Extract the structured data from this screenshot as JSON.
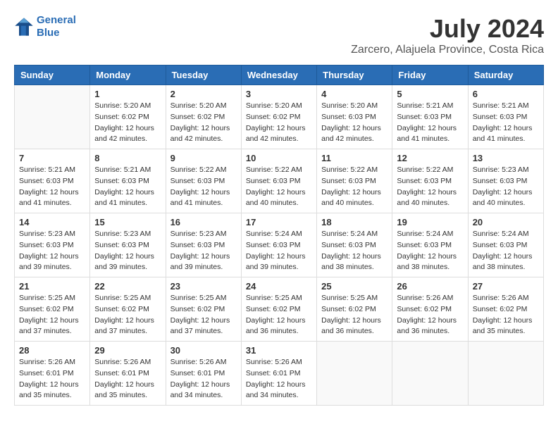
{
  "logo": {
    "name1": "General",
    "name2": "Blue"
  },
  "title": {
    "month_year": "July 2024",
    "location": "Zarcero, Alajuela Province, Costa Rica"
  },
  "weekdays": [
    "Sunday",
    "Monday",
    "Tuesday",
    "Wednesday",
    "Thursday",
    "Friday",
    "Saturday"
  ],
  "weeks": [
    [
      {
        "day": "",
        "info": ""
      },
      {
        "day": "1",
        "info": "Sunrise: 5:20 AM\nSunset: 6:02 PM\nDaylight: 12 hours\nand 42 minutes."
      },
      {
        "day": "2",
        "info": "Sunrise: 5:20 AM\nSunset: 6:02 PM\nDaylight: 12 hours\nand 42 minutes."
      },
      {
        "day": "3",
        "info": "Sunrise: 5:20 AM\nSunset: 6:02 PM\nDaylight: 12 hours\nand 42 minutes."
      },
      {
        "day": "4",
        "info": "Sunrise: 5:20 AM\nSunset: 6:03 PM\nDaylight: 12 hours\nand 42 minutes."
      },
      {
        "day": "5",
        "info": "Sunrise: 5:21 AM\nSunset: 6:03 PM\nDaylight: 12 hours\nand 41 minutes."
      },
      {
        "day": "6",
        "info": "Sunrise: 5:21 AM\nSunset: 6:03 PM\nDaylight: 12 hours\nand 41 minutes."
      }
    ],
    [
      {
        "day": "7",
        "info": "Sunrise: 5:21 AM\nSunset: 6:03 PM\nDaylight: 12 hours\nand 41 minutes."
      },
      {
        "day": "8",
        "info": "Sunrise: 5:21 AM\nSunset: 6:03 PM\nDaylight: 12 hours\nand 41 minutes."
      },
      {
        "day": "9",
        "info": "Sunrise: 5:22 AM\nSunset: 6:03 PM\nDaylight: 12 hours\nand 41 minutes."
      },
      {
        "day": "10",
        "info": "Sunrise: 5:22 AM\nSunset: 6:03 PM\nDaylight: 12 hours\nand 40 minutes."
      },
      {
        "day": "11",
        "info": "Sunrise: 5:22 AM\nSunset: 6:03 PM\nDaylight: 12 hours\nand 40 minutes."
      },
      {
        "day": "12",
        "info": "Sunrise: 5:22 AM\nSunset: 6:03 PM\nDaylight: 12 hours\nand 40 minutes."
      },
      {
        "day": "13",
        "info": "Sunrise: 5:23 AM\nSunset: 6:03 PM\nDaylight: 12 hours\nand 40 minutes."
      }
    ],
    [
      {
        "day": "14",
        "info": "Sunrise: 5:23 AM\nSunset: 6:03 PM\nDaylight: 12 hours\nand 39 minutes."
      },
      {
        "day": "15",
        "info": "Sunrise: 5:23 AM\nSunset: 6:03 PM\nDaylight: 12 hours\nand 39 minutes."
      },
      {
        "day": "16",
        "info": "Sunrise: 5:23 AM\nSunset: 6:03 PM\nDaylight: 12 hours\nand 39 minutes."
      },
      {
        "day": "17",
        "info": "Sunrise: 5:24 AM\nSunset: 6:03 PM\nDaylight: 12 hours\nand 39 minutes."
      },
      {
        "day": "18",
        "info": "Sunrise: 5:24 AM\nSunset: 6:03 PM\nDaylight: 12 hours\nand 38 minutes."
      },
      {
        "day": "19",
        "info": "Sunrise: 5:24 AM\nSunset: 6:03 PM\nDaylight: 12 hours\nand 38 minutes."
      },
      {
        "day": "20",
        "info": "Sunrise: 5:24 AM\nSunset: 6:03 PM\nDaylight: 12 hours\nand 38 minutes."
      }
    ],
    [
      {
        "day": "21",
        "info": "Sunrise: 5:25 AM\nSunset: 6:02 PM\nDaylight: 12 hours\nand 37 minutes."
      },
      {
        "day": "22",
        "info": "Sunrise: 5:25 AM\nSunset: 6:02 PM\nDaylight: 12 hours\nand 37 minutes."
      },
      {
        "day": "23",
        "info": "Sunrise: 5:25 AM\nSunset: 6:02 PM\nDaylight: 12 hours\nand 37 minutes."
      },
      {
        "day": "24",
        "info": "Sunrise: 5:25 AM\nSunset: 6:02 PM\nDaylight: 12 hours\nand 36 minutes."
      },
      {
        "day": "25",
        "info": "Sunrise: 5:25 AM\nSunset: 6:02 PM\nDaylight: 12 hours\nand 36 minutes."
      },
      {
        "day": "26",
        "info": "Sunrise: 5:26 AM\nSunset: 6:02 PM\nDaylight: 12 hours\nand 36 minutes."
      },
      {
        "day": "27",
        "info": "Sunrise: 5:26 AM\nSunset: 6:02 PM\nDaylight: 12 hours\nand 35 minutes."
      }
    ],
    [
      {
        "day": "28",
        "info": "Sunrise: 5:26 AM\nSunset: 6:01 PM\nDaylight: 12 hours\nand 35 minutes."
      },
      {
        "day": "29",
        "info": "Sunrise: 5:26 AM\nSunset: 6:01 PM\nDaylight: 12 hours\nand 35 minutes."
      },
      {
        "day": "30",
        "info": "Sunrise: 5:26 AM\nSunset: 6:01 PM\nDaylight: 12 hours\nand 34 minutes."
      },
      {
        "day": "31",
        "info": "Sunrise: 5:26 AM\nSunset: 6:01 PM\nDaylight: 12 hours\nand 34 minutes."
      },
      {
        "day": "",
        "info": ""
      },
      {
        "day": "",
        "info": ""
      },
      {
        "day": "",
        "info": ""
      }
    ]
  ]
}
